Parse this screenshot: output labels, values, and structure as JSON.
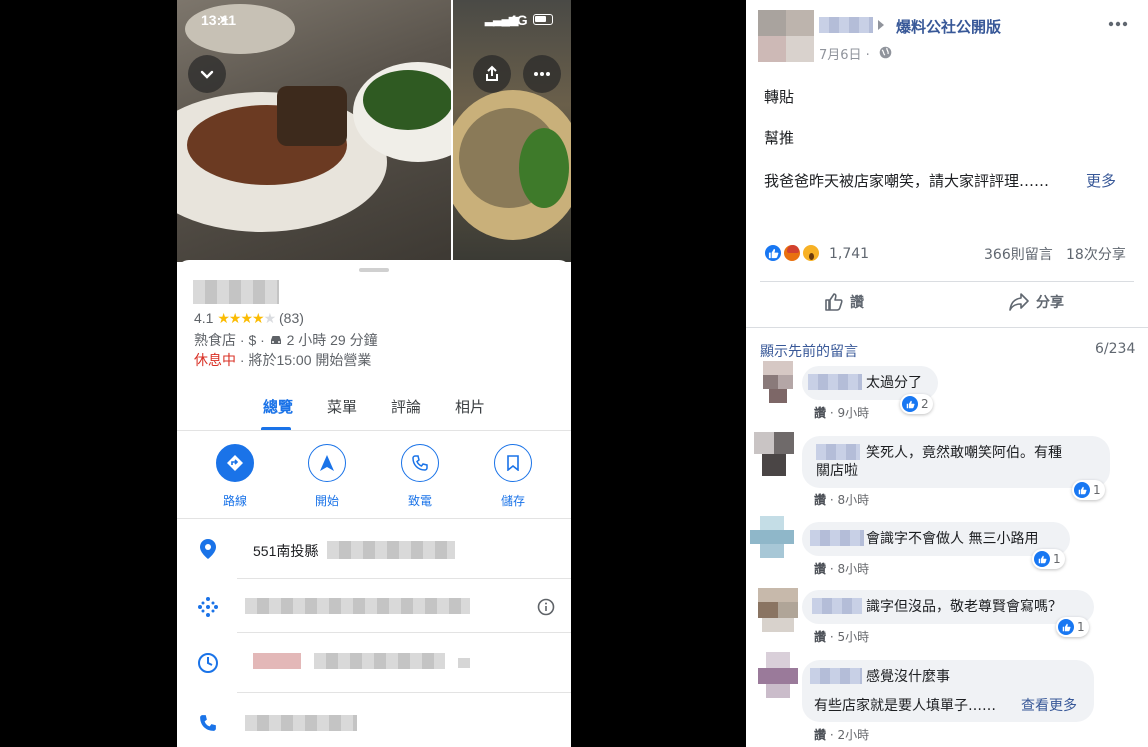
{
  "phone": {
    "status_time": "13:11",
    "network": "4G",
    "place": {
      "rating": "4.1",
      "review_count": "(83)",
      "details_a": "熟食店 · $ ·",
      "details_b": "2 小時 29 分鐘",
      "status": "休息中",
      "hours": " · 將於15:00 開始營業"
    },
    "tabs": [
      "總覽",
      "菜單",
      "評論",
      "相片"
    ],
    "actions": [
      "路線",
      "開始",
      "致電",
      "儲存"
    ],
    "address_prefix": "551南投縣"
  },
  "post": {
    "page_name": "爆料公社公開版",
    "date": "7月6日 ·",
    "lines": [
      "轉貼",
      "幫推",
      "我爸爸昨天被店家嘲笑，請大家評評理……"
    ],
    "see_more": "更多",
    "reaction_count": "1,741",
    "comment_count": "366則留言",
    "share_count": "18次分享",
    "like_label": "讚",
    "share_label": "分享",
    "prev_comments": "顯示先前的留言",
    "comment_position": "6/234",
    "comments": [
      {
        "text": "太過分了",
        "time": "9小時",
        "likes": "2"
      },
      {
        "text": "笑死人，竟然敢嘲笑阿伯。有種",
        "text2": "關店啦",
        "time": "8小時",
        "likes": "1"
      },
      {
        "text": "會識字不會做人 無三小路用",
        "time": "8小時",
        "likes": "1"
      },
      {
        "text": "識字但沒品，敬老尊賢會寫嗎？",
        "time": "5小時",
        "likes": "1"
      },
      {
        "text": "感覺沒什麼事",
        "text2": "有些店家就是要人填單子……",
        "see_more": "查看更多",
        "time": "2小時"
      }
    ]
  },
  "colors": {
    "google_blue": "#1a73e8",
    "closed_red": "#d93025",
    "fb_blue": "#385898",
    "fb_link": "#216fdb"
  }
}
